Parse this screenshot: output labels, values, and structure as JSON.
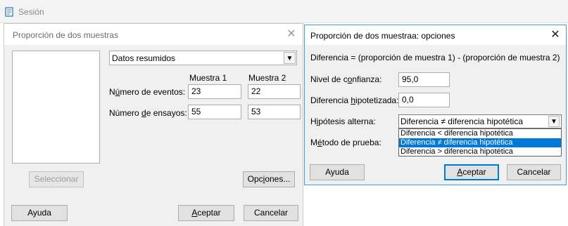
{
  "session": {
    "title": "Sesión"
  },
  "dialog1": {
    "title": "Proporción de dos muestras",
    "data_select": "Datos resumidos",
    "col_headers": [
      "Muestra 1",
      "Muestra 2"
    ],
    "rows": [
      {
        "label": "Número de eventos:",
        "values": [
          "23",
          "22"
        ]
      },
      {
        "label": "Número de ensayos:",
        "values": [
          "55",
          "53"
        ]
      }
    ],
    "buttons": {
      "select": "Seleccionar",
      "options": "Opciones...",
      "help": "Ayuda",
      "ok": "Aceptar",
      "cancel": "Cancelar"
    }
  },
  "dialog2": {
    "title": "Proporción de dos muestraa: opciones",
    "formula": "Diferencia = (proporción de muestra 1) - (proporción de muestra 2)",
    "confidence": {
      "label": "Nivel de confianza:",
      "value": "95,0"
    },
    "hypothesized": {
      "label": "Diferencia hipotetizada:",
      "value": "0,0"
    },
    "alternative": {
      "label": "Hipótesis alterna:",
      "value": "Diferencia ≠ diferencia hipotética",
      "options": [
        "Diferencia < diferencia hipotética",
        "Diferencia ≠ diferencia hipotética",
        "Diferencia > diferencia hipotética"
      ]
    },
    "method": {
      "label": "Método de prueba:"
    },
    "buttons": {
      "help": "Ayuda",
      "ok": "Aceptar",
      "cancel": "Cancelar"
    }
  },
  "colors": {
    "accent": "#0078d7",
    "window_bg": "#f0f0f0"
  }
}
